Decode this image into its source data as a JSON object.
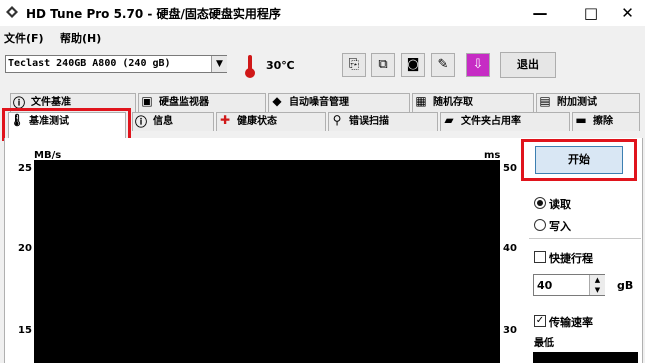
{
  "window": {
    "title": "HD Tune Pro 5.70 - 硬盘/固态硬盘实用程序",
    "minimize": "—",
    "maximize": "□",
    "close": "✕"
  },
  "menu": {
    "file": "文件(F)",
    "help": "帮助(H)"
  },
  "toolbar": {
    "drive": "Teclast 240GB A800 (240 gB)",
    "temperature": "30℃",
    "exit_label": "退出",
    "icons": [
      "copy-icon",
      "copy-all-icon",
      "camera-icon",
      "options-icon",
      "save-icon"
    ]
  },
  "tabs_row1": [
    {
      "label": "文件基准",
      "icon": "info-icon"
    },
    {
      "label": "硬盘监视器",
      "icon": "monitor-icon"
    },
    {
      "label": "自动噪音管理",
      "icon": "speaker-icon"
    },
    {
      "label": "随机存取",
      "icon": "random-access-icon"
    },
    {
      "label": "附加测试",
      "icon": "extra-tests-icon"
    }
  ],
  "tabs_row2": [
    {
      "label": "基准测试",
      "icon": "thermometer-icon"
    },
    {
      "label": "信息",
      "icon": "info-icon"
    },
    {
      "label": "健康状态",
      "icon": "health-icon"
    },
    {
      "label": "错误扫描",
      "icon": "search-icon"
    },
    {
      "label": "文件夹占用率",
      "icon": "folder-icon"
    },
    {
      "label": "擦除",
      "icon": "erase-icon"
    }
  ],
  "chart": {
    "left_unit": "MB/s",
    "right_unit": "ms",
    "left_ticks": [
      "25",
      "20",
      "15"
    ],
    "right_ticks": [
      "50",
      "40",
      "30"
    ]
  },
  "controls": {
    "start": "开始",
    "read": "读取",
    "write": "写入",
    "short_stroke": "快捷行程",
    "short_stroke_value": "40",
    "short_stroke_unit": "gB",
    "transfer_rate": "传输速率",
    "min_label": "最低"
  }
}
